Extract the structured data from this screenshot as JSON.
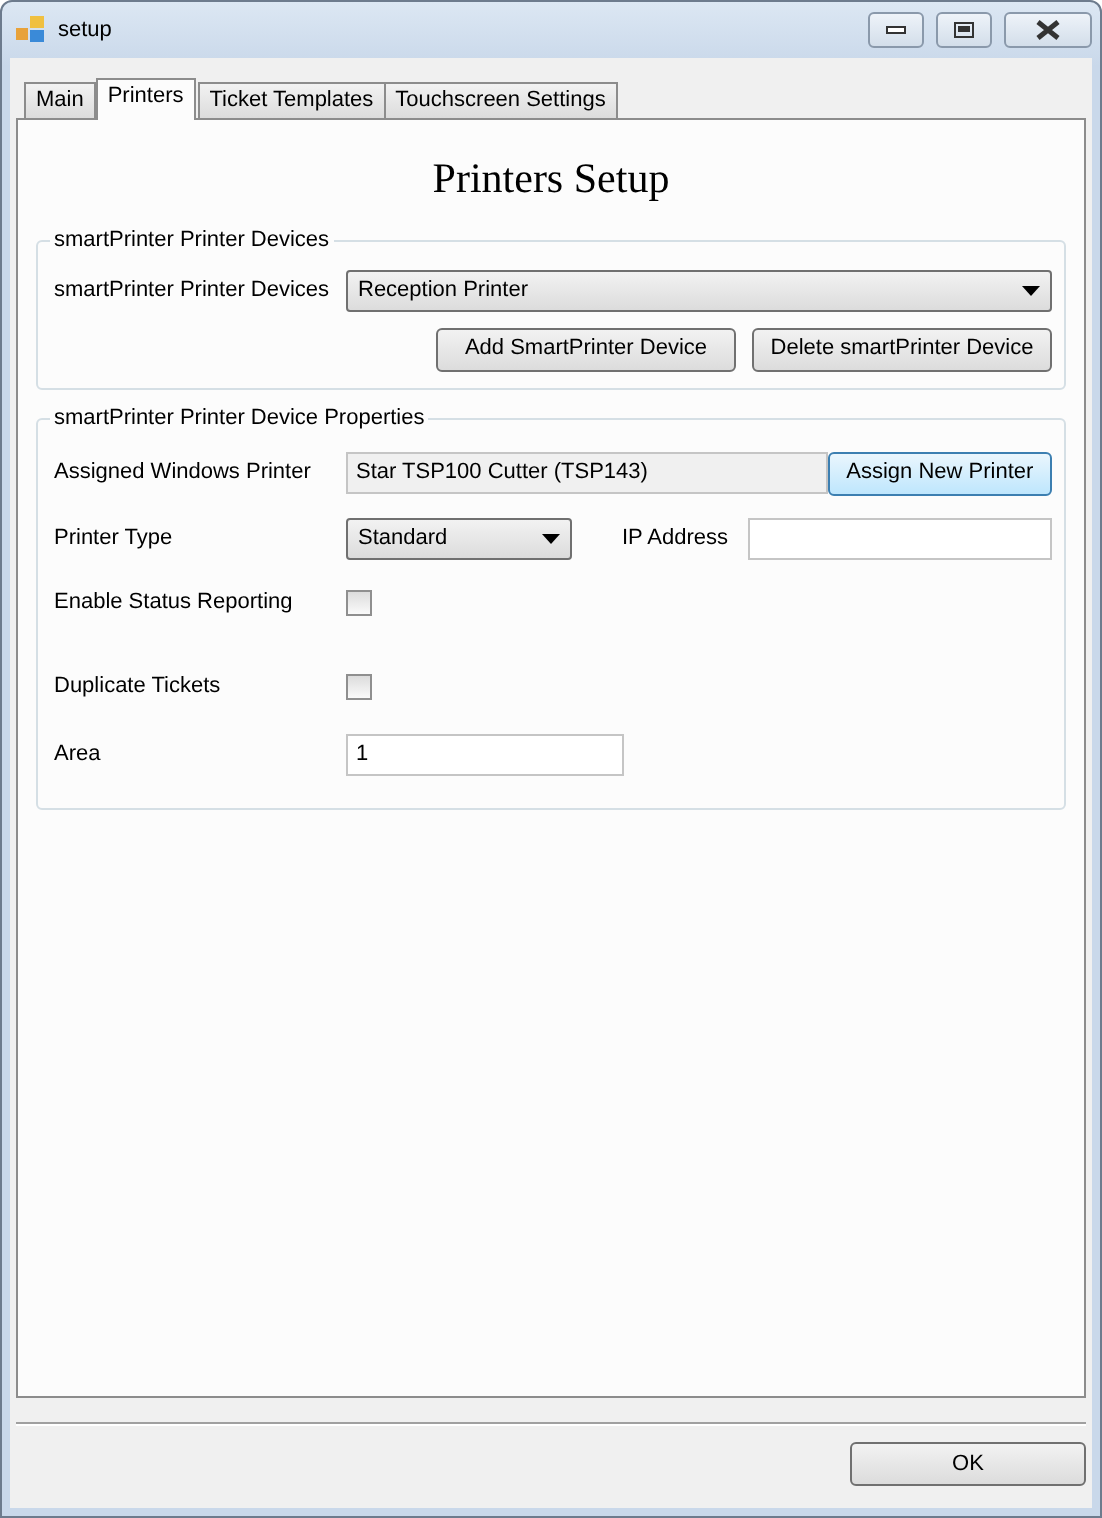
{
  "window": {
    "title": "setup"
  },
  "tabs": [
    {
      "label": "Main",
      "selected": false
    },
    {
      "label": "Printers",
      "selected": true
    },
    {
      "label": "Ticket Templates",
      "selected": false
    },
    {
      "label": "Touchscreen Settings",
      "selected": false
    }
  ],
  "heading": "Printers Setup",
  "devices_group": {
    "title": "smartPrinter Printer Devices",
    "label": "smartPrinter Printer Devices",
    "selected_device": "Reception Printer",
    "buttons": [
      "Add SmartPrinter Device",
      "Delete smartPrinter Device"
    ]
  },
  "properties_group": {
    "title": "smartPrinter Printer Device Properties",
    "rows": [
      {
        "kind": "readonly",
        "label": "Assigned Windows Printer",
        "value": "Star TSP100 Cutter (TSP143)",
        "button": "Assign New Printer"
      },
      {
        "kind": "select",
        "label": "Printer Type",
        "value": "Standard",
        "side_label": "IP Address"
      },
      {
        "kind": "checkbox",
        "label": "Enable Status Reporting",
        "checked": false
      },
      {
        "kind": "checkbox",
        "label": "Duplicate Tickets",
        "checked": false
      },
      {
        "kind": "input",
        "label": "Area",
        "value": "1"
      }
    ]
  },
  "buttons": [
    "OK"
  ]
}
